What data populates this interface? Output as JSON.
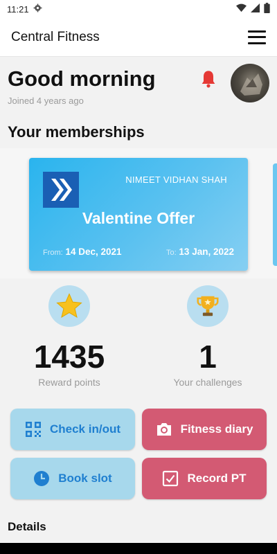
{
  "status": {
    "time": "11:21"
  },
  "app": {
    "title": "Central Fitness"
  },
  "greeting": {
    "text": "Good morning",
    "joined": "Joined 4 years ago"
  },
  "memberships": {
    "heading": "Your memberships",
    "card": {
      "holder": "NIMEET VIDHAN SHAH",
      "plan": "Valentine Offer",
      "from_label": "From:",
      "from_date": "14 Dec, 2021",
      "to_label": "To:",
      "to_date": "13 Jan, 2022"
    }
  },
  "stats": {
    "rewards": {
      "value": "1435",
      "label": "Reward points",
      "icon": "star-icon"
    },
    "challenges": {
      "value": "1",
      "label": "Your challenges",
      "icon": "trophy-icon"
    }
  },
  "actions": {
    "checkin": {
      "label": "Check in/out",
      "icon": "qr-code-icon"
    },
    "diary": {
      "label": "Fitness diary",
      "icon": "camera-icon"
    },
    "book": {
      "label": "Book slot",
      "icon": "clock-icon"
    },
    "record": {
      "label": "Record PT",
      "icon": "checkbox-icon"
    }
  },
  "details": {
    "heading": "Details"
  },
  "colors": {
    "accent_blue": "#1f7fd0",
    "button_blue": "#a7d8ec",
    "button_red": "#d35a73",
    "bell_red": "#e53935",
    "card_blue": "#2ab4ee"
  }
}
